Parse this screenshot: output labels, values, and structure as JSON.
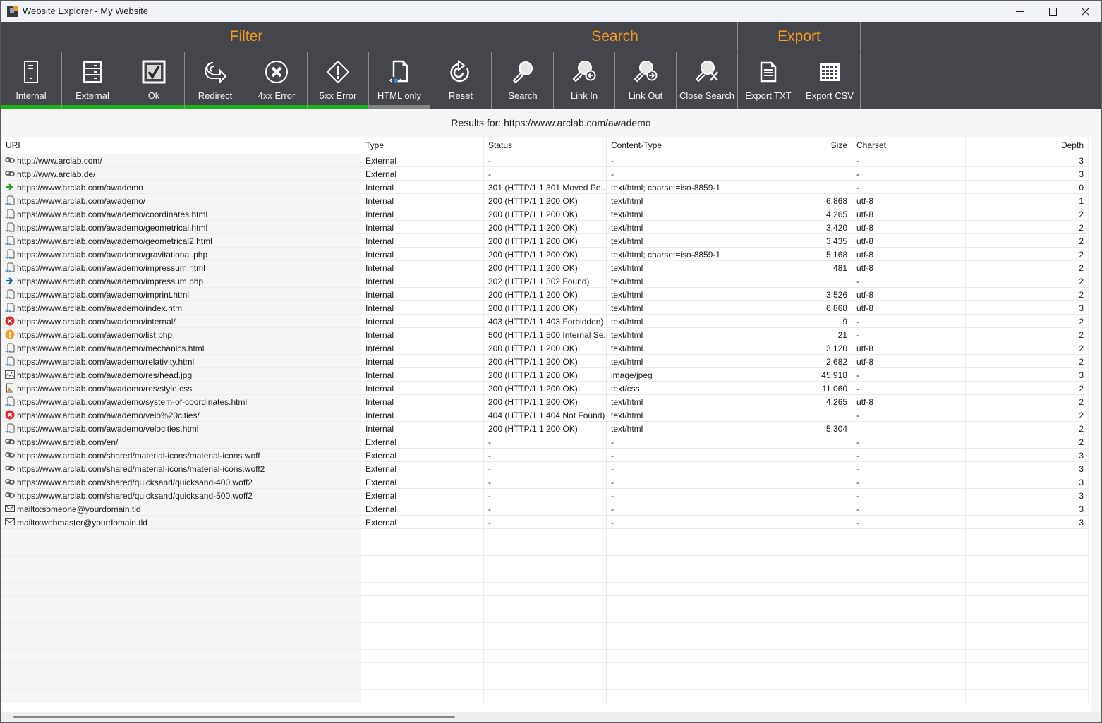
{
  "window": {
    "title": "Website Explorer - My Website",
    "controls": {
      "minimize": "minimize-icon",
      "maximize": "maximize-icon",
      "close": "close-icon"
    }
  },
  "ribbon": {
    "colors": {
      "accent": "#f29b1f",
      "active_bar": "#1db31d",
      "inactive_bar": "#838683",
      "background": "#45464c"
    },
    "groups": [
      {
        "label": "Filter"
      },
      {
        "label": "Search"
      },
      {
        "label": "Export"
      }
    ],
    "filter_tools": [
      {
        "label": "Internal",
        "icon": "server-single-icon",
        "active": true
      },
      {
        "label": "External",
        "icon": "server-stack-icon",
        "active": true
      },
      {
        "label": "Ok",
        "icon": "checkbox-icon",
        "active": true
      },
      {
        "label": "Redirect",
        "icon": "redirect-arrow-icon",
        "active": true
      },
      {
        "label": "4xx Error",
        "icon": "circle-x-icon",
        "active": true
      },
      {
        "label": "5xx Error",
        "icon": "octagon-alert-icon",
        "active": true
      },
      {
        "label": "HTML only",
        "icon": "html-file-icon",
        "active": false
      },
      {
        "label": "Reset",
        "icon": "reset-icon"
      }
    ],
    "search_tools": [
      {
        "label": "Search",
        "icon": "magnifier-icon"
      },
      {
        "label": "Link In",
        "icon": "magnifier-link-in-icon"
      },
      {
        "label": "Link Out",
        "icon": "magnifier-link-out-icon"
      },
      {
        "label": "Close Search",
        "icon": "magnifier-close-icon"
      }
    ],
    "export_tools": [
      {
        "label": "Export TXT",
        "icon": "text-document-icon"
      },
      {
        "label": "Export CSV",
        "icon": "spreadsheet-icon"
      }
    ]
  },
  "results": {
    "caption": "Results for: https://www.arclab.com/awademo",
    "columns": [
      "URI",
      "Type",
      "Status",
      "Content-Type",
      "Size",
      "Charset",
      "Depth"
    ],
    "rows": [
      {
        "icon": "link",
        "uri": "http://www.arclab.com/",
        "type": "External",
        "status": "-",
        "content_type": "-",
        "size": "",
        "charset": "-",
        "depth": "3"
      },
      {
        "icon": "link",
        "uri": "http://www.arclab.de/",
        "type": "External",
        "status": "-",
        "content_type": "-",
        "size": "",
        "charset": "-",
        "depth": "3"
      },
      {
        "icon": "redirect-green",
        "uri": "https://www.arclab.com/awademo",
        "type": "Internal",
        "status": "301 (HTTP/1.1 301 Moved Pe...",
        "content_type": "text/html; charset=iso-8859-1",
        "size": "",
        "charset": "-",
        "depth": "0"
      },
      {
        "icon": "html",
        "uri": "https://www.arclab.com/awademo/",
        "type": "Internal",
        "status": "200 (HTTP/1.1 200 OK)",
        "content_type": "text/html",
        "size": "6,868",
        "charset": "utf-8",
        "depth": "1"
      },
      {
        "icon": "html",
        "uri": "https://www.arclab.com/awademo/coordinates.html",
        "type": "Internal",
        "status": "200 (HTTP/1.1 200 OK)",
        "content_type": "text/html",
        "size": "4,265",
        "charset": "utf-8",
        "depth": "2"
      },
      {
        "icon": "html",
        "uri": "https://www.arclab.com/awademo/geometrical.html",
        "type": "Internal",
        "status": "200 (HTTP/1.1 200 OK)",
        "content_type": "text/html",
        "size": "3,420",
        "charset": "utf-8",
        "depth": "2"
      },
      {
        "icon": "html",
        "uri": "https://www.arclab.com/awademo/geometrical2.html",
        "type": "Internal",
        "status": "200 (HTTP/1.1 200 OK)",
        "content_type": "text/html",
        "size": "3,435",
        "charset": "utf-8",
        "depth": "2"
      },
      {
        "icon": "html",
        "uri": "https://www.arclab.com/awademo/gravitational.php",
        "type": "Internal",
        "status": "200 (HTTP/1.1 200 OK)",
        "content_type": "text/html; charset=iso-8859-1",
        "size": "5,168",
        "charset": "utf-8",
        "depth": "2"
      },
      {
        "icon": "html",
        "uri": "https://www.arclab.com/awademo/impressum.html",
        "type": "Internal",
        "status": "200 (HTTP/1.1 200 OK)",
        "content_type": "text/html",
        "size": "481",
        "charset": "utf-8",
        "depth": "2"
      },
      {
        "icon": "redirect-blue",
        "uri": "https://www.arclab.com/awademo/impressum.php",
        "type": "Internal",
        "status": "302 (HTTP/1.1 302 Found)",
        "content_type": "text/html",
        "size": "",
        "charset": "-",
        "depth": "2"
      },
      {
        "icon": "html",
        "uri": "https://www.arclab.com/awademo/imprint.html",
        "type": "Internal",
        "status": "200 (HTTP/1.1 200 OK)",
        "content_type": "text/html",
        "size": "3,526",
        "charset": "utf-8",
        "depth": "2"
      },
      {
        "icon": "html",
        "uri": "https://www.arclab.com/awademo/index.html",
        "type": "Internal",
        "status": "200 (HTTP/1.1 200 OK)",
        "content_type": "text/html",
        "size": "6,868",
        "charset": "utf-8",
        "depth": "3"
      },
      {
        "icon": "error",
        "uri": "https://www.arclab.com/awademo/internal/",
        "type": "Internal",
        "status": "403 (HTTP/1.1 403 Forbidden)",
        "content_type": "text/html",
        "size": "9",
        "charset": "-",
        "depth": "2"
      },
      {
        "icon": "warning",
        "uri": "https://www.arclab.com/awademo/list.php",
        "type": "Internal",
        "status": "500 (HTTP/1.1 500 Internal Se...",
        "content_type": "text/html",
        "size": "21",
        "charset": "-",
        "depth": "2"
      },
      {
        "icon": "html",
        "uri": "https://www.arclab.com/awademo/mechanics.html",
        "type": "Internal",
        "status": "200 (HTTP/1.1 200 OK)",
        "content_type": "text/html",
        "size": "3,120",
        "charset": "utf-8",
        "depth": "2"
      },
      {
        "icon": "html",
        "uri": "https://www.arclab.com/awademo/relativity.html",
        "type": "Internal",
        "status": "200 (HTTP/1.1 200 OK)",
        "content_type": "text/html",
        "size": "2,682",
        "charset": "utf-8",
        "depth": "2"
      },
      {
        "icon": "image",
        "uri": "https://www.arclab.com/awademo/res/head.jpg",
        "type": "Internal",
        "status": "200 (HTTP/1.1 200 OK)",
        "content_type": "image/jpeg",
        "size": "45,918",
        "charset": "-",
        "depth": "3"
      },
      {
        "icon": "css",
        "uri": "https://www.arclab.com/awademo/res/style.css",
        "type": "Internal",
        "status": "200 (HTTP/1.1 200 OK)",
        "content_type": "text/css",
        "size": "11,060",
        "charset": "-",
        "depth": "2"
      },
      {
        "icon": "html",
        "uri": "https://www.arclab.com/awademo/system-of-coordinates.html",
        "type": "Internal",
        "status": "200 (HTTP/1.1 200 OK)",
        "content_type": "text/html",
        "size": "4,265",
        "charset": "utf-8",
        "depth": "2"
      },
      {
        "icon": "error",
        "uri": "https://www.arclab.com/awademo/velo%20cities/",
        "type": "Internal",
        "status": "404 (HTTP/1.1 404 Not Found)",
        "content_type": "text/html",
        "size": "",
        "charset": "-",
        "depth": "2"
      },
      {
        "icon": "html",
        "uri": "https://www.arclab.com/awademo/velocities.html",
        "type": "Internal",
        "status": "200 (HTTP/1.1 200 OK)",
        "content_type": "text/html",
        "size": "5,304",
        "charset": "",
        "depth": "2"
      },
      {
        "icon": "link",
        "uri": "https://www.arclab.com/en/",
        "type": "External",
        "status": "-",
        "content_type": "-",
        "size": "",
        "charset": "-",
        "depth": "2"
      },
      {
        "icon": "link",
        "uri": "https://www.arclab.com/shared/material-icons/material-icons.woff",
        "type": "External",
        "status": "-",
        "content_type": "-",
        "size": "",
        "charset": "-",
        "depth": "3"
      },
      {
        "icon": "link",
        "uri": "https://www.arclab.com/shared/material-icons/material-icons.woff2",
        "type": "External",
        "status": "-",
        "content_type": "-",
        "size": "",
        "charset": "-",
        "depth": "3"
      },
      {
        "icon": "link",
        "uri": "https://www.arclab.com/shared/quicksand/quicksand-400.woff2",
        "type": "External",
        "status": "-",
        "content_type": "-",
        "size": "",
        "charset": "-",
        "depth": "3"
      },
      {
        "icon": "link",
        "uri": "https://www.arclab.com/shared/quicksand/quicksand-500.woff2",
        "type": "External",
        "status": "-",
        "content_type": "-",
        "size": "",
        "charset": "-",
        "depth": "3"
      },
      {
        "icon": "mail",
        "uri": "mailto:someone@yourdomain.tld",
        "type": "External",
        "status": "-",
        "content_type": "-",
        "size": "",
        "charset": "-",
        "depth": "3"
      },
      {
        "icon": "mail",
        "uri": "mailto:webmaster@yourdomain.tld",
        "type": "External",
        "status": "-",
        "content_type": "-",
        "size": "",
        "charset": "-",
        "depth": "3"
      }
    ]
  }
}
